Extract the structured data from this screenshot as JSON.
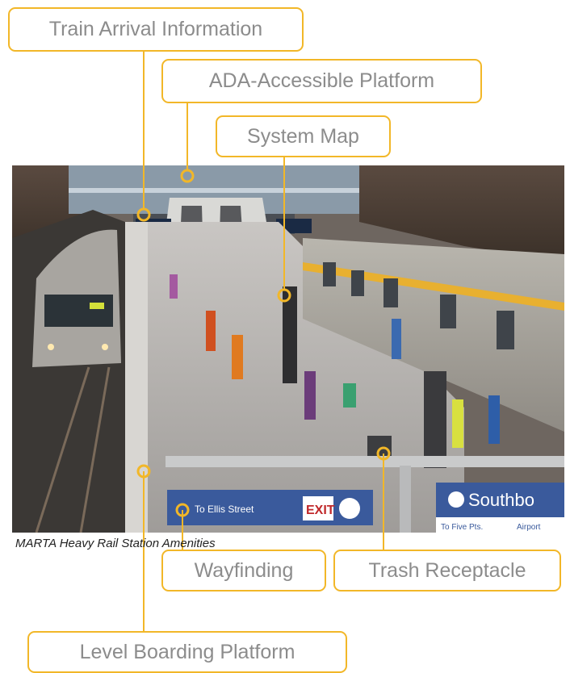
{
  "callouts": {
    "train_arrival": "Train Arrival Information",
    "ada_platform": "ADA-Accessible Platform",
    "system_map": "System Map",
    "wayfinding": "Wayfinding",
    "trash": "Trash Receptacle",
    "level_boarding": "Level Boarding Platform"
  },
  "caption": "MARTA Heavy Rail Station Amenities",
  "photo_signs": {
    "directional": "To Ellis Street",
    "exit": "EXIT",
    "southbound": "Southbo",
    "southbound_sub": "To Five Pts.",
    "airport": "Airport"
  },
  "colors": {
    "accent": "#f2b728",
    "label_text": "#8c8c8c",
    "sign_blue": "#3a5a9c"
  }
}
